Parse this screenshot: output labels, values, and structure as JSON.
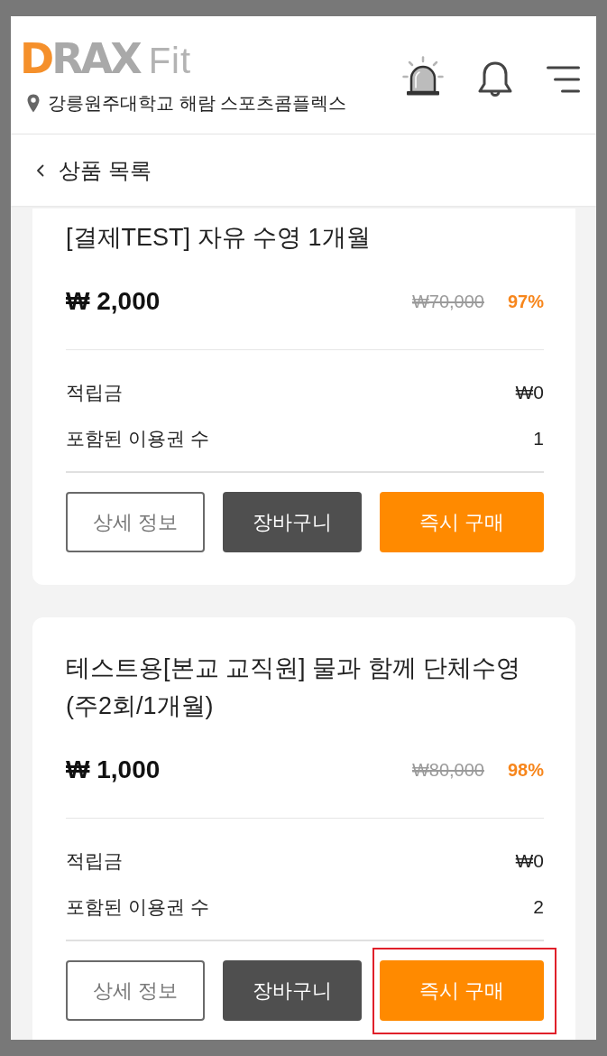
{
  "header": {
    "logo": {
      "accent": "D",
      "rest": "RAX",
      "suffix": "Fit"
    },
    "location": "강릉원주대학교 해람 스포츠콤플렉스"
  },
  "page_title": {
    "title": "상품 목록"
  },
  "products": [
    {
      "title": "[결제TEST] 자유 수영 1개월",
      "price": "₩ 2,000",
      "original_price": "₩70,000",
      "discount": "97%",
      "details": [
        {
          "label": "적립금",
          "value": "₩0"
        },
        {
          "label": "포함된 이용권 수",
          "value": "1"
        }
      ],
      "buttons": [
        {
          "label": "상세 정보",
          "kind": "outline",
          "highlighted": false
        },
        {
          "label": "장바구니",
          "kind": "dark",
          "highlighted": false
        },
        {
          "label": "즉시 구매",
          "kind": "primary",
          "highlighted": false
        }
      ]
    },
    {
      "title": "테스트용[본교 교직원] 물과 함께 단체수영(주2회/1개월)",
      "price": "₩ 1,000",
      "original_price": "₩80,000",
      "discount": "98%",
      "details": [
        {
          "label": "적립금",
          "value": "₩0"
        },
        {
          "label": "포함된 이용권 수",
          "value": "2"
        }
      ],
      "buttons": [
        {
          "label": "상세 정보",
          "kind": "outline",
          "highlighted": false
        },
        {
          "label": "장바구니",
          "kind": "dark",
          "highlighted": false
        },
        {
          "label": "즉시 구매",
          "kind": "primary",
          "highlighted": true
        }
      ]
    }
  ]
}
